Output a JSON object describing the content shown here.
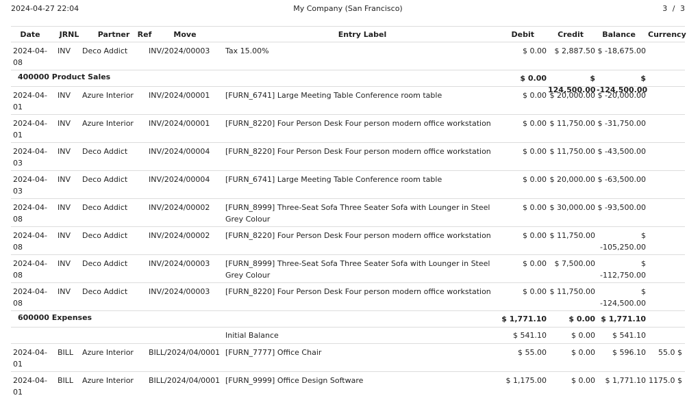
{
  "header": {
    "datetime": "2024-04-27 22:04",
    "company": "My Company (San Francisco)",
    "pages": "3 / 3"
  },
  "columns": {
    "date": "Date",
    "jrnl": "JRNL",
    "partner": "Partner",
    "ref": "Ref",
    "move": "Move",
    "label": "Entry Label",
    "debit": "Debit",
    "credit": "Credit",
    "balance": "Balance",
    "currency": "Currency"
  },
  "rows": [
    {
      "date": "2024-04-08",
      "jrnl": "INV",
      "partner": "Deco Addict",
      "ref": "",
      "move": "INV/2024/00003",
      "label": "Tax 15.00%",
      "debit": "$ 0.00",
      "credit": "$ 2,887.50",
      "balance": "$ -18,675.00",
      "currency": ""
    },
    {
      "date": "2024-04-01",
      "jrnl": "INV",
      "partner": "Azure Interior",
      "ref": "",
      "move": "INV/2024/00001",
      "label": "[FURN_6741] Large Meeting Table Conference room table",
      "debit": "$ 0.00",
      "credit": "$ 20,000.00",
      "balance": "$ -20,000.00",
      "currency": ""
    },
    {
      "date": "2024-04-01",
      "jrnl": "INV",
      "partner": "Azure Interior",
      "ref": "",
      "move": "INV/2024/00001",
      "label": "[FURN_8220] Four Person Desk Four person modern office workstation",
      "debit": "$ 0.00",
      "credit": "$ 11,750.00",
      "balance": "$ -31,750.00",
      "currency": ""
    },
    {
      "date": "2024-04-03",
      "jrnl": "INV",
      "partner": "Deco Addict",
      "ref": "",
      "move": "INV/2024/00004",
      "label": "[FURN_8220] Four Person Desk Four person modern office workstation",
      "debit": "$ 0.00",
      "credit": "$ 11,750.00",
      "balance": "$ -43,500.00",
      "currency": ""
    },
    {
      "date": "2024-04-03",
      "jrnl": "INV",
      "partner": "Deco Addict",
      "ref": "",
      "move": "INV/2024/00004",
      "label": "[FURN_6741] Large Meeting Table Conference room table",
      "debit": "$ 0.00",
      "credit": "$ 20,000.00",
      "balance": "$ -63,500.00",
      "currency": ""
    },
    {
      "date": "2024-04-08",
      "jrnl": "INV",
      "partner": "Deco Addict",
      "ref": "",
      "move": "INV/2024/00002",
      "label": "[FURN_8999] Three-Seat Sofa Three Seater Sofa with Lounger in Steel Grey Colour",
      "debit": "$ 0.00",
      "credit": "$ 30,000.00",
      "balance": "$ -93,500.00",
      "currency": ""
    },
    {
      "date": "2024-04-08",
      "jrnl": "INV",
      "partner": "Deco Addict",
      "ref": "",
      "move": "INV/2024/00002",
      "label": "[FURN_8220] Four Person Desk Four person modern office workstation",
      "debit": "$ 0.00",
      "credit": "$ 11,750.00",
      "balance": "$ -105,250.00",
      "currency": ""
    },
    {
      "date": "2024-04-08",
      "jrnl": "INV",
      "partner": "Deco Addict",
      "ref": "",
      "move": "INV/2024/00003",
      "label": "[FURN_8999] Three-Seat Sofa Three Seater Sofa with Lounger in Steel Grey Colour",
      "debit": "$ 0.00",
      "credit": "$ 7,500.00",
      "balance": "$ -112,750.00",
      "currency": ""
    },
    {
      "date": "2024-04-08",
      "jrnl": "INV",
      "partner": "Deco Addict",
      "ref": "",
      "move": "INV/2024/00003",
      "label": "[FURN_8220] Four Person Desk Four person modern office workstation",
      "debit": "$ 0.00",
      "credit": "$ 11,750.00",
      "balance": "$ -124,500.00",
      "currency": ""
    },
    {
      "date": "",
      "jrnl": "",
      "partner": "",
      "ref": "",
      "move": "",
      "label": "Initial Balance",
      "debit": "$ 541.10",
      "credit": "$ 0.00",
      "balance": "$ 541.10",
      "currency": ""
    },
    {
      "date": "2024-04-01",
      "jrnl": "BILL",
      "partner": "Azure Interior",
      "ref": "",
      "move": "BILL/2024/04/0001",
      "label": "[FURN_7777] Office Chair",
      "debit": "$ 55.00",
      "credit": "$ 0.00",
      "balance": "$ 596.10",
      "currency": "55.0 $"
    },
    {
      "date": "2024-04-01",
      "jrnl": "BILL",
      "partner": "Azure Interior",
      "ref": "",
      "move": "BILL/2024/04/0001",
      "label": "[FURN_9999] Office Design Software",
      "debit": "$ 1,175.00",
      "credit": "$ 0.00",
      "balance": "$ 1,771.10",
      "currency": "1175.0 $"
    }
  ],
  "groups": [
    {
      "title": "400000 Product Sales",
      "debit": "$ 0.00",
      "credit": "$ 124,500.00",
      "balance": "$ -124,500.00"
    },
    {
      "title": "600000 Expenses",
      "debit": "$ 1,771.10",
      "credit": "$ 0.00",
      "balance": "$ 1,771.10"
    }
  ]
}
